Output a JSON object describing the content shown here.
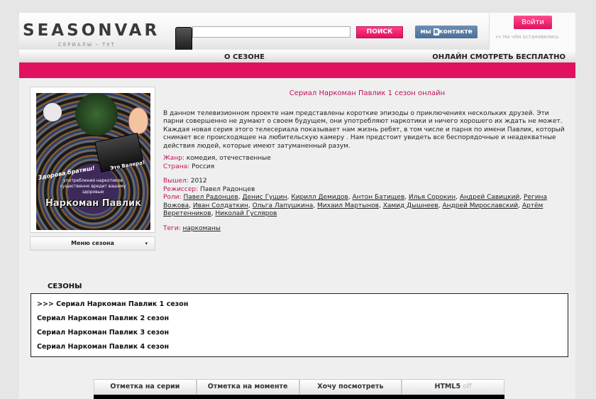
{
  "header": {
    "logo_main": "SEASONVAR",
    "logo_sub_left": "СЕРИАЛЫ",
    "logo_sub_dash": " - ",
    "logo_sub_right": "ТУТ",
    "search_value": "",
    "search_button": "ПОИСК",
    "vk_prefix": "мы ",
    "vk_brand": "в",
    "vk_suffix": "контакте",
    "login_button": "Войти",
    "status_text": "На чём остановились"
  },
  "nav": {
    "about": "О СЕЗОНЕ",
    "online": "ОНЛАЙН СМОТРЕТЬ БЕСПЛАТНО"
  },
  "poster": {
    "caption1": "Здорова братиш!",
    "caption2": "Это Валера!",
    "warning": "употребления наркотиков существенно вредит вашему здоровью",
    "title": "Наркоман Павлик"
  },
  "season_menu": "Меню сезона",
  "series": {
    "title": "Сериал Наркоман Павлик 1 сезон онлайн",
    "description": "В данном телевизионном проекте нам представлены короткие эпизоды о приключениях нескольких друзей. Эти парни совершенно не думают о своем будущем, они употребляют наркотики и ничего хорошего их ждать не может. Каждая новая серия этого телесериала показывает нам жизнь ребят, в том числе и парня по имени Павлик, который снимает все происходящее на любительскую камеру . Нам предстоит увидеть все беспорядочные и неадекватные действия людей, которые имеют затуманенный разум.",
    "genre_label": "Жанр:",
    "genre": "комедия, отечественные",
    "country_label": "Страна:",
    "country": "Россия",
    "year_label": "Вышел:",
    "year": "2012",
    "director_label": "Режиссер:",
    "director": "Павел Радонцев",
    "roles_label": "Роли:",
    "roles": [
      "Павел Радонцев",
      "Денис Гущин",
      "Кирилл Демидов",
      "Антон Батищев",
      "Илья Сорокин",
      "Андрей Савицкий",
      "Регина Вожова",
      "Иван Солдаткин",
      "Ольга Лапушкина",
      "Михаил Мартынов",
      "Хамид Дышнеев",
      "Андрей Мирославский",
      "Артём Веретенников",
      "Николай Гусляров"
    ],
    "tags_label": "Теги:",
    "tags": [
      "наркоманы"
    ]
  },
  "seasons": {
    "heading": "СЕЗОНЫ",
    "items": [
      ">>> Сериал Наркоман Павлик 1 сезон",
      "Сериал Наркоман Павлик 2 сезон",
      "Сериал Наркоман Павлик 3 сезон",
      "Сериал Наркоман Павлик 4 сезон"
    ]
  },
  "player_tabs": {
    "mark_series": "Отметка на серии",
    "mark_moment": "Отметка на моменте",
    "want_watch": "Хочу посмотреть",
    "html5": "HTML5",
    "html5_state": "off"
  }
}
